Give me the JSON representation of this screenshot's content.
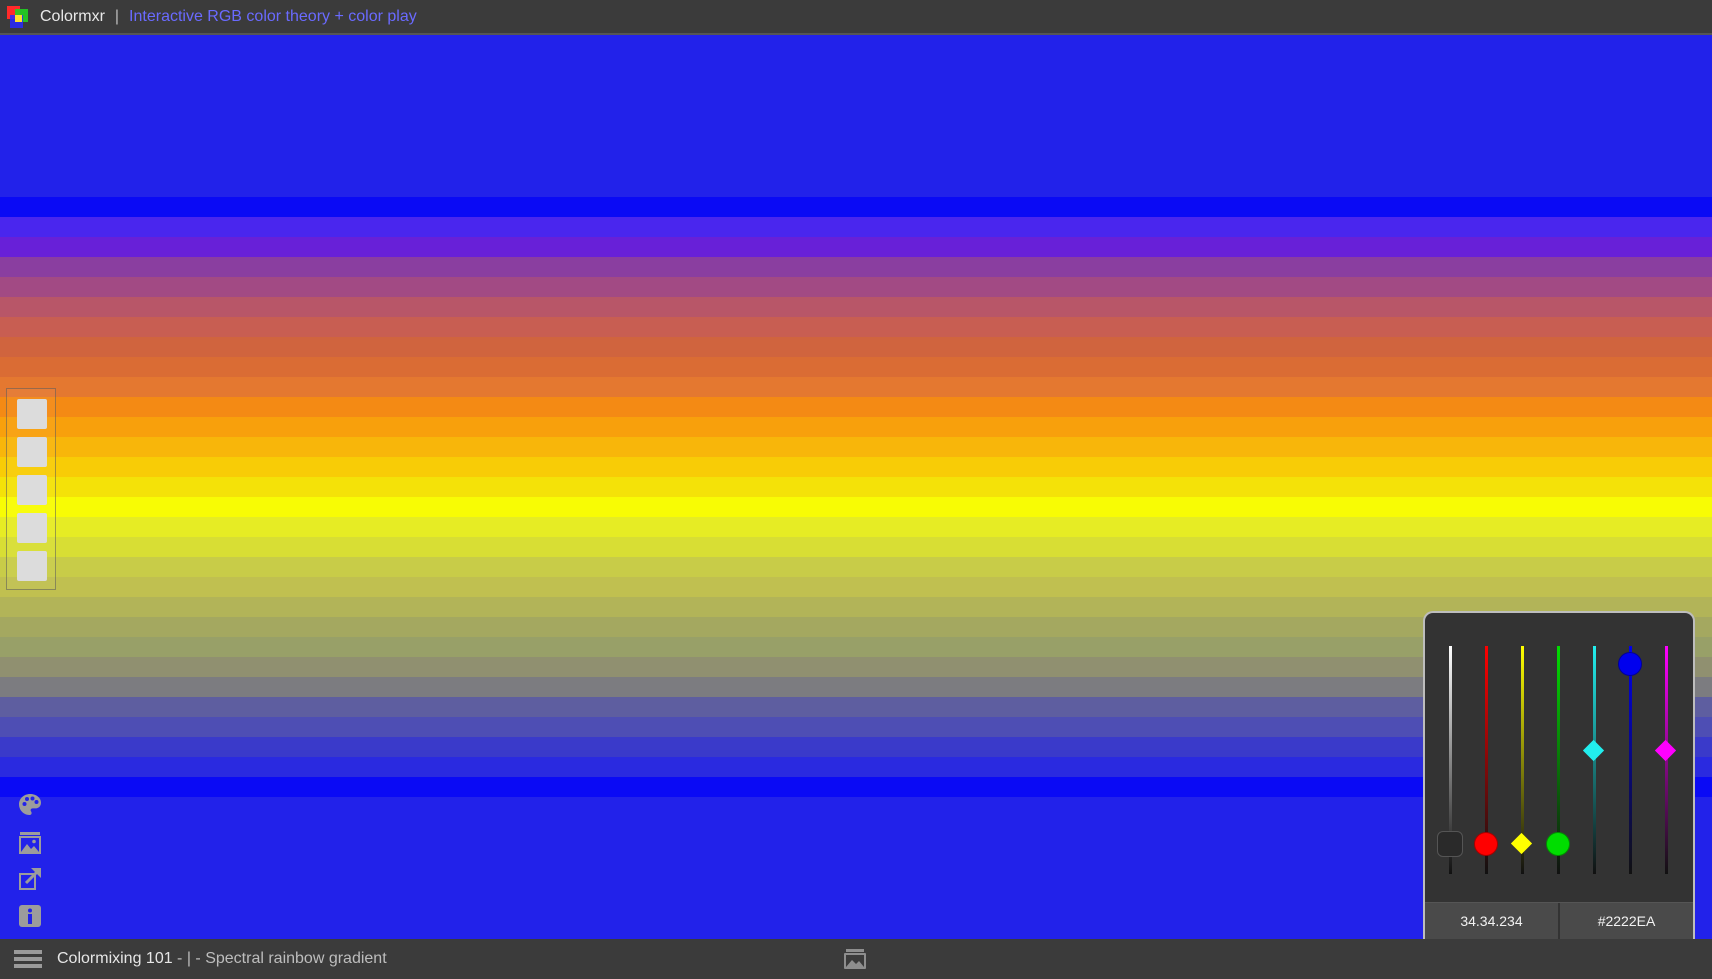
{
  "header": {
    "app_name": "Colormxr",
    "separator": "|",
    "tagline": "Interactive RGB color theory + color play"
  },
  "canvas": {
    "background": "#2222EA",
    "bands": [
      {
        "color": "#0A0AF5"
      },
      {
        "color": "#4A26EE"
      },
      {
        "color": "#6820D8"
      },
      {
        "color": "#8A3EA0"
      },
      {
        "color": "#A24A84"
      },
      {
        "color": "#B85668"
      },
      {
        "color": "#C85E52"
      },
      {
        "color": "#D0643E"
      },
      {
        "color": "#DA6C34"
      },
      {
        "color": "#E47830"
      },
      {
        "color": "#F48A14"
      },
      {
        "color": "#F8A00C"
      },
      {
        "color": "#F8B60A"
      },
      {
        "color": "#F8CC06"
      },
      {
        "color": "#F4E208"
      },
      {
        "color": "#F8FC04"
      },
      {
        "color": "#E6EC24"
      },
      {
        "color": "#D8DE34"
      },
      {
        "color": "#C8CC48"
      },
      {
        "color": "#C0C050"
      },
      {
        "color": "#B2B458"
      },
      {
        "color": "#A4A860"
      },
      {
        "color": "#98A068"
      },
      {
        "color": "#909070"
      },
      {
        "color": "#7C7C80"
      },
      {
        "color": "#5E5EA0"
      },
      {
        "color": "#4E4EB4"
      },
      {
        "color": "#3A3ACA"
      },
      {
        "color": "#2A2AE0"
      },
      {
        "color": "#0A0AF5"
      }
    ]
  },
  "swatches": [
    {
      "color": "#DCDCDC"
    },
    {
      "color": "#DCDCDC"
    },
    {
      "color": "#DCDCDC"
    },
    {
      "color": "#DCDCDC"
    },
    {
      "color": "#DCDCDC"
    }
  ],
  "tools": [
    {
      "icon": "palette-icon"
    },
    {
      "icon": "image-gallery-icon"
    },
    {
      "icon": "export-icon"
    },
    {
      "icon": "info-icon"
    }
  ],
  "mixer": {
    "channels": [
      {
        "name": "white",
        "color": "#FFFFFF",
        "value": 0.13,
        "knob": "rounded-square"
      },
      {
        "name": "red",
        "color": "#FF0000",
        "value": 0.13,
        "knob": "circle"
      },
      {
        "name": "yellow",
        "color": "#FFFF00",
        "value": 0.13,
        "knob": "diamond"
      },
      {
        "name": "green",
        "color": "#00DD00",
        "value": 0.13,
        "knob": "circle"
      },
      {
        "name": "cyan",
        "color": "#22EEEE",
        "value": 0.54,
        "knob": "diamond"
      },
      {
        "name": "blue",
        "color": "#0000EE",
        "value": 0.92,
        "knob": "circle"
      },
      {
        "name": "magenta",
        "color": "#FF00FF",
        "value": 0.54,
        "knob": "diamond"
      }
    ],
    "rgb_readout": "34.34.234",
    "hex_readout": "#2222EA"
  },
  "footer": {
    "preset_title": "Colormixing 101",
    "sep1": " - ",
    "sep2": "|",
    "description": " - Spectral rainbow gradient"
  }
}
